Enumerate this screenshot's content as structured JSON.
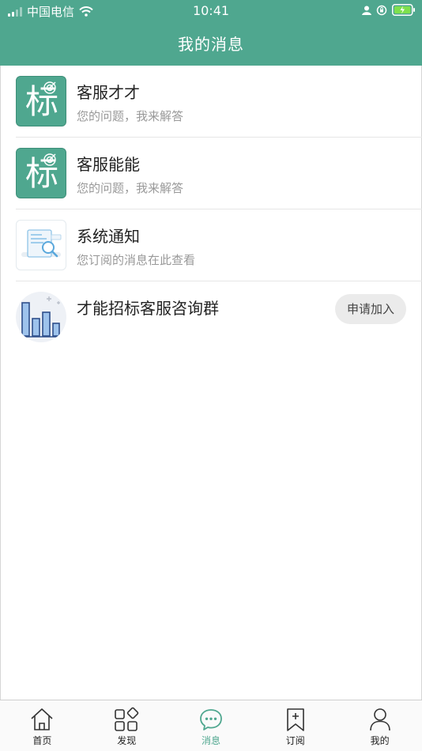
{
  "status_bar": {
    "carrier": "中国电信",
    "time": "10:41"
  },
  "header": {
    "title": "我的消息"
  },
  "messages": [
    {
      "title": "客服才才",
      "subtitle": "您的问题，我来解答",
      "avatar_char": "标"
    },
    {
      "title": "客服能能",
      "subtitle": "您的问题，我来解答",
      "avatar_char": "标"
    },
    {
      "title": "系统通知",
      "subtitle": "您订阅的消息在此查看"
    },
    {
      "title": "才能招标客服咨询群",
      "button": "申请加入"
    }
  ],
  "tabs": [
    {
      "label": "首页",
      "icon": "home-icon"
    },
    {
      "label": "发现",
      "icon": "discover-icon"
    },
    {
      "label": "消息",
      "icon": "message-icon"
    },
    {
      "label": "订阅",
      "icon": "bookmark-add-icon"
    },
    {
      "label": "我的",
      "icon": "user-icon"
    }
  ],
  "active_tab": "消息",
  "colors": {
    "accent": "#4fa78f",
    "divider": "#e6e6e6",
    "subtitle": "#999999"
  }
}
